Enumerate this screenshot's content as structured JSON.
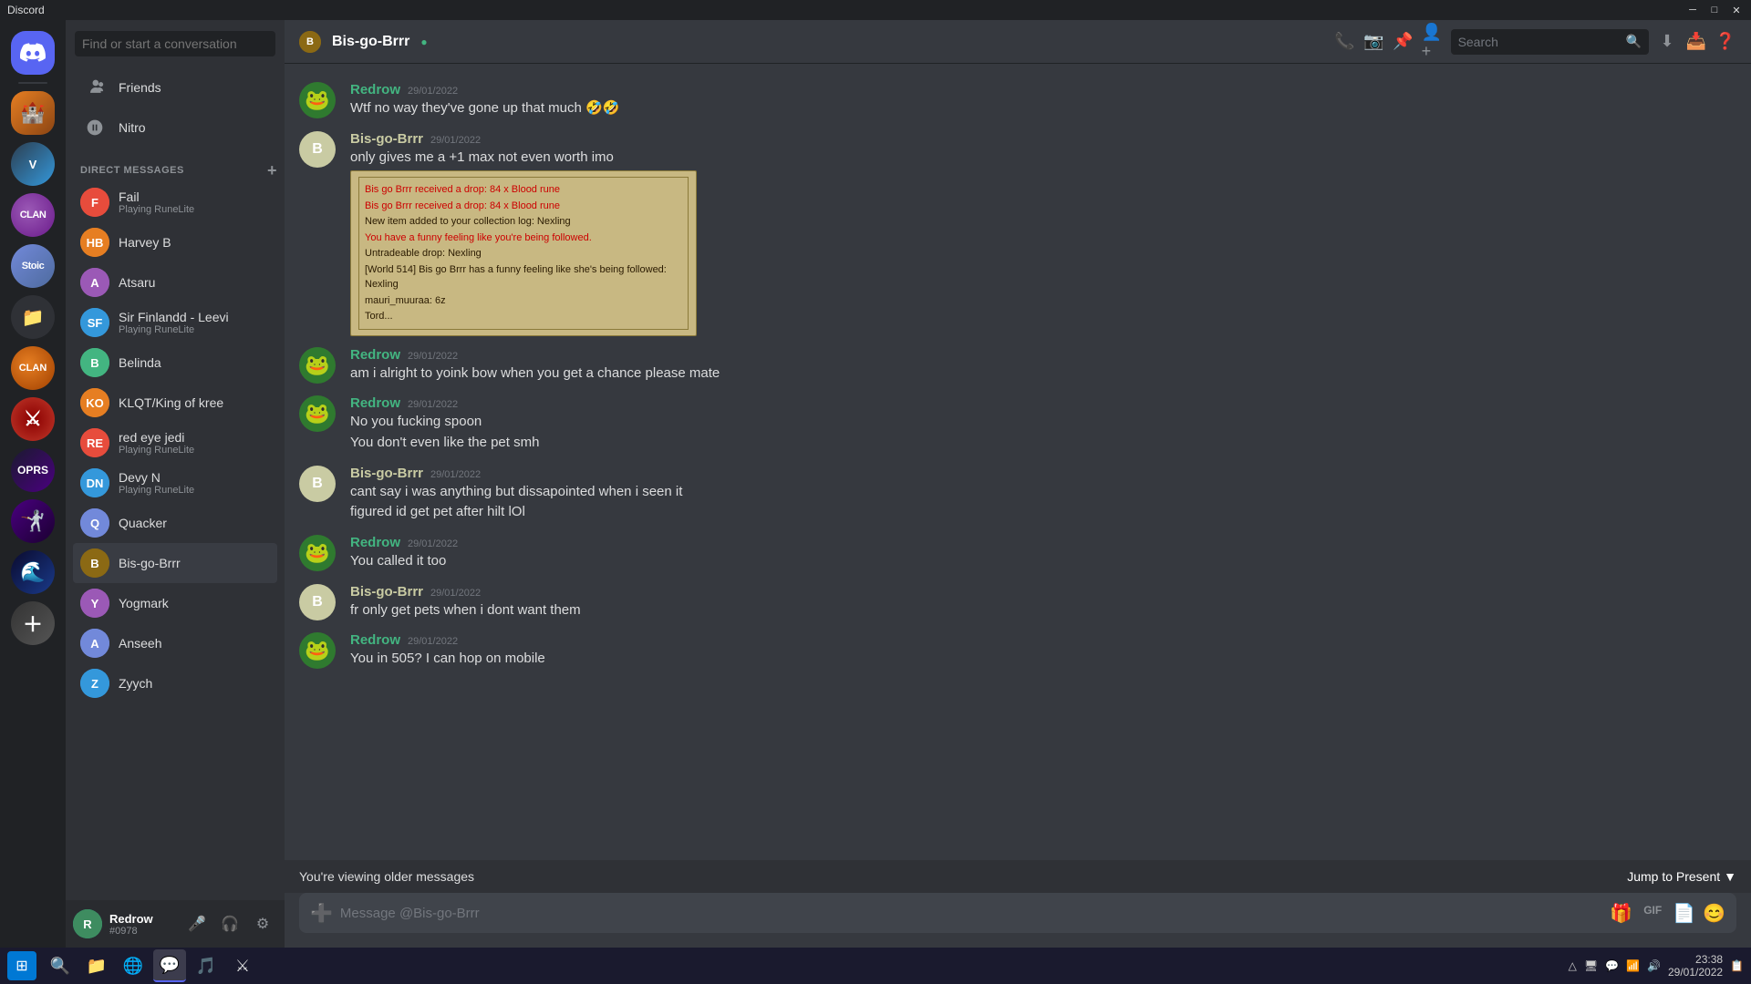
{
  "titlebar": {
    "title": "Discord",
    "minimize": "─",
    "maximize": "□",
    "close": "✕"
  },
  "search": {
    "placeholder": "Search"
  },
  "dm_sidebar": {
    "search_placeholder": "Find or start a conversation",
    "friends_label": "Friends",
    "nitro_label": "Nitro",
    "dm_header": "DIRECT MESSAGES",
    "dm_list": [
      {
        "name": "Fail",
        "sub": "Playing RuneLite",
        "color": "#e74c3c"
      },
      {
        "name": "Harvey B",
        "sub": "",
        "color": "#e67e22"
      },
      {
        "name": "Atsaru",
        "sub": "",
        "color": "#9b59b6"
      },
      {
        "name": "Sir Finlandd - Leevi",
        "sub": "Playing RuneLite",
        "color": "#3498db"
      },
      {
        "name": "Belinda",
        "sub": "",
        "color": "#43b581"
      },
      {
        "name": "KLQT/King of kree",
        "sub": "",
        "color": "#e67e22"
      },
      {
        "name": "red eye jedi",
        "sub": "Playing RuneLite",
        "color": "#e74c3c"
      },
      {
        "name": "Devy N",
        "sub": "Playing RuneLite",
        "color": "#3498db"
      },
      {
        "name": "Quacker",
        "sub": "",
        "color": "#7289da"
      },
      {
        "name": "Bis-go-Brrr",
        "sub": "",
        "color": "#8b6914",
        "active": true
      },
      {
        "name": "Yogmark",
        "sub": "",
        "color": "#9b59b6"
      },
      {
        "name": "Anseeh",
        "sub": "",
        "color": "#7289da"
      },
      {
        "name": "Zyych",
        "sub": "",
        "color": "#3498db"
      }
    ]
  },
  "chat": {
    "channel_name": "Bis-go-Brrr",
    "messages": [
      {
        "id": "msg1",
        "author": "Redrow",
        "author_color": "#43b581",
        "timestamp": "29/01/2022",
        "avatar_type": "frog",
        "lines": [
          "Wtf no way they've gone up that much 🤣🤣"
        ]
      },
      {
        "id": "msg2",
        "author": "Bis-go-Brrr",
        "author_color": "#c9cba3",
        "timestamp": "29/01/2022",
        "avatar_type": "brown",
        "lines": [
          "only gives me a +1 max not even worth imo"
        ],
        "has_embed": true,
        "embed_lines": [
          {
            "text": "Bis go Brrr received a drop: 84 x Blood rune",
            "style": "red"
          },
          {
            "text": "Bis go Brrr received a drop: 84 x Blood rune",
            "style": "red"
          },
          {
            "text": "New item added to your collection log: Nexling",
            "style": "dark"
          },
          {
            "text": "You have a funny feeling like you're being followed.",
            "style": "red"
          },
          {
            "text": "Untradeable drop: Nexling",
            "style": "dark"
          },
          {
            "text": "[World 514] Bis go Brrr has a funny feeling like she's being followed: Nexling",
            "style": "dark"
          },
          {
            "text": "mauri_muuraa: 6z",
            "style": "dark"
          },
          {
            "text": "Tord...",
            "style": "dark"
          }
        ]
      },
      {
        "id": "msg3",
        "author": "Redrow",
        "author_color": "#43b581",
        "timestamp": "29/01/2022",
        "avatar_type": "frog",
        "lines": [
          "am i alright to yoink bow when you get a chance please mate"
        ]
      },
      {
        "id": "msg4",
        "author": "Redrow",
        "author_color": "#43b581",
        "timestamp": "29/01/2022",
        "avatar_type": "frog",
        "lines": [
          "No you fucking spoon",
          "You don't even like the pet smh"
        ]
      },
      {
        "id": "msg5",
        "author": "Bis-go-Brrr",
        "author_color": "#c9cba3",
        "timestamp": "29/01/2022",
        "avatar_type": "brown",
        "lines": [
          "cant say i was anything but dissapointed when i seen it",
          "figured id get pet after hilt lOl"
        ]
      },
      {
        "id": "msg6",
        "author": "Redrow",
        "author_color": "#43b581",
        "timestamp": "29/01/2022",
        "avatar_type": "frog",
        "lines": [
          "You called it too"
        ]
      },
      {
        "id": "msg7",
        "author": "Bis-go-Brrr",
        "author_color": "#c9cba3",
        "timestamp": "29/01/2022",
        "avatar_type": "brown",
        "lines": [
          "fr only get pets when i dont want them"
        ]
      },
      {
        "id": "msg8",
        "author": "Redrow",
        "author_color": "#43b581",
        "timestamp": "29/01/2022",
        "avatar_type": "frog",
        "lines": [
          "You in 505? I can hop on mobile"
        ]
      }
    ],
    "older_messages_label": "You're viewing older messages",
    "jump_to_present": "Jump to Present",
    "message_placeholder": "Message @Bis-go-Brrr"
  },
  "user": {
    "name": "Redrow",
    "tag": "#0978"
  },
  "taskbar": {
    "time": "23:38",
    "apps": [
      "⊞",
      "🔍",
      "📁",
      "🌐",
      "💬",
      "🎵",
      "⚔"
    ]
  }
}
